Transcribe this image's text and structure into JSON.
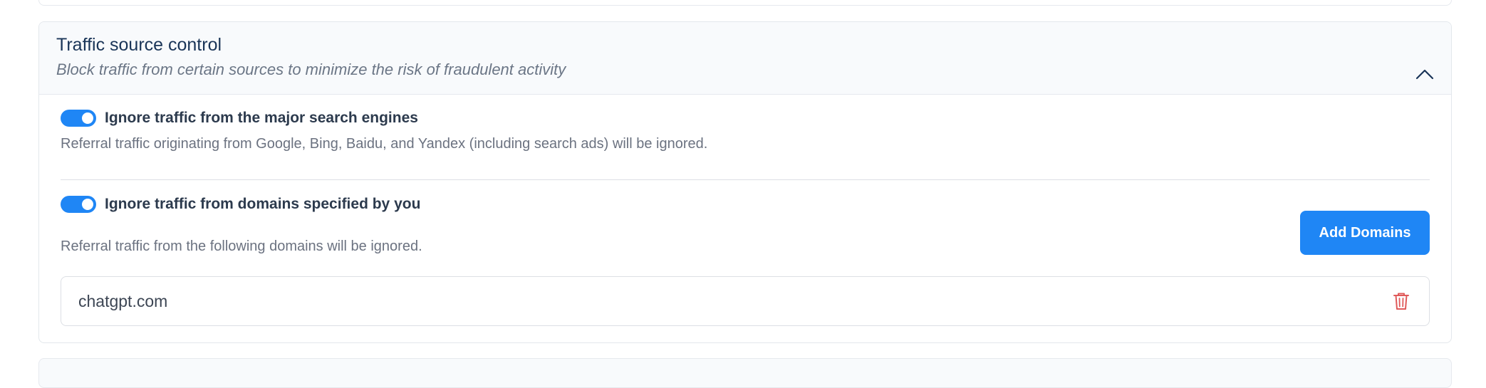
{
  "section": {
    "title": "Traffic source control",
    "subtitle": "Block traffic from certain sources to minimize the risk of fraudulent activity",
    "collapse_icon": "chevron-up-icon"
  },
  "options": [
    {
      "title": "Ignore traffic from the major search engines",
      "description": "Referral traffic originating from Google, Bing, Baidu, and Yandex (including search ads) will be ignored.",
      "enabled": true
    },
    {
      "title": "Ignore traffic from domains specified by you",
      "description": "Referral traffic from the following domains will be ignored.",
      "enabled": true,
      "add_button_label": "Add Domains",
      "domains": [
        {
          "name": "chatgpt.com",
          "delete_icon": "trash-icon"
        }
      ]
    }
  ],
  "colors": {
    "accent": "#1f86f5",
    "title": "#1a3558",
    "delete": "#e05a5a"
  }
}
